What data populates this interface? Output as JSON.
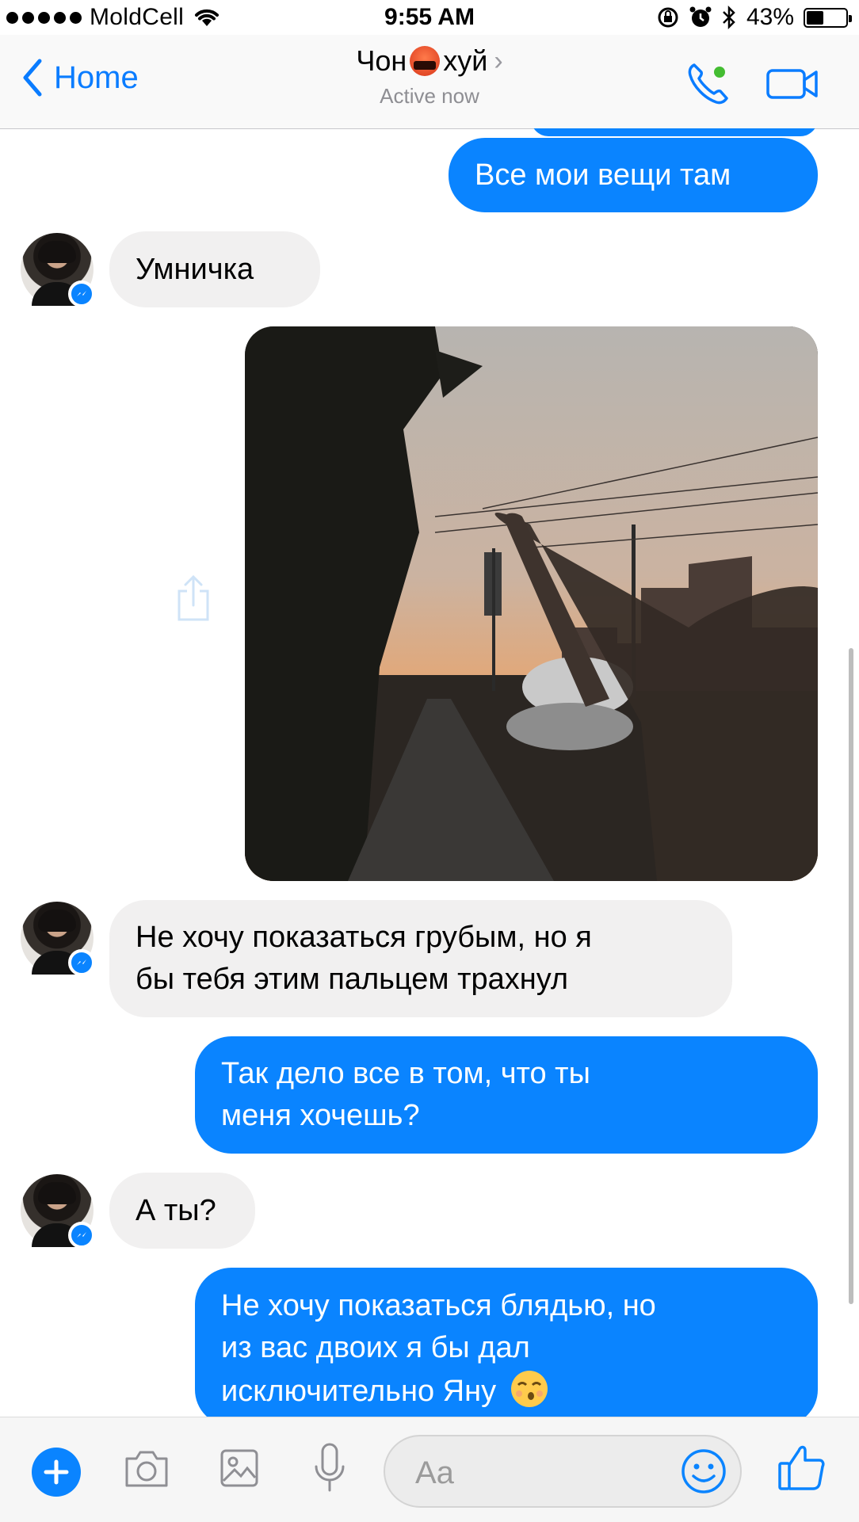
{
  "status_bar": {
    "carrier": "MoldCell",
    "time": "9:55 AM",
    "battery_percent": "43%",
    "battery_level": 0.43
  },
  "nav": {
    "back_label": "Home",
    "title_left": "Чон",
    "title_right": "хуй",
    "title_emoji": "angry-cursing-face",
    "status": "Active now",
    "accent_color": "#0a7cff",
    "online_dot_color": "#44bd32"
  },
  "messages": [
    {
      "side": "out",
      "text": "Все мои вещи там"
    },
    {
      "side": "in",
      "text": "Умничка"
    },
    {
      "side": "out",
      "type": "photo",
      "content": "evening street, sunset sky, middle finger gesture"
    },
    {
      "side": "in",
      "text": "Не хочу показаться грубым, но я\nбы тебя этим пальцем трахнул"
    },
    {
      "side": "out",
      "text": "Так дело все в том, что ты\nменя хочешь?"
    },
    {
      "side": "in",
      "text": "А ты?"
    },
    {
      "side": "out",
      "text": "Не хочу показаться блядью, но\nиз вас двоих я бы дал\nисключительно Яну",
      "emoji": "kissing-face"
    }
  ],
  "composer": {
    "placeholder": "Aa",
    "icons": [
      "plus-icon",
      "camera-icon",
      "gallery-icon",
      "microphone-icon",
      "emoji-icon",
      "thumbs-up-icon"
    ]
  },
  "colors": {
    "outgoing_bubble": "#0a84ff",
    "incoming_bubble": "#f1f0f0"
  }
}
